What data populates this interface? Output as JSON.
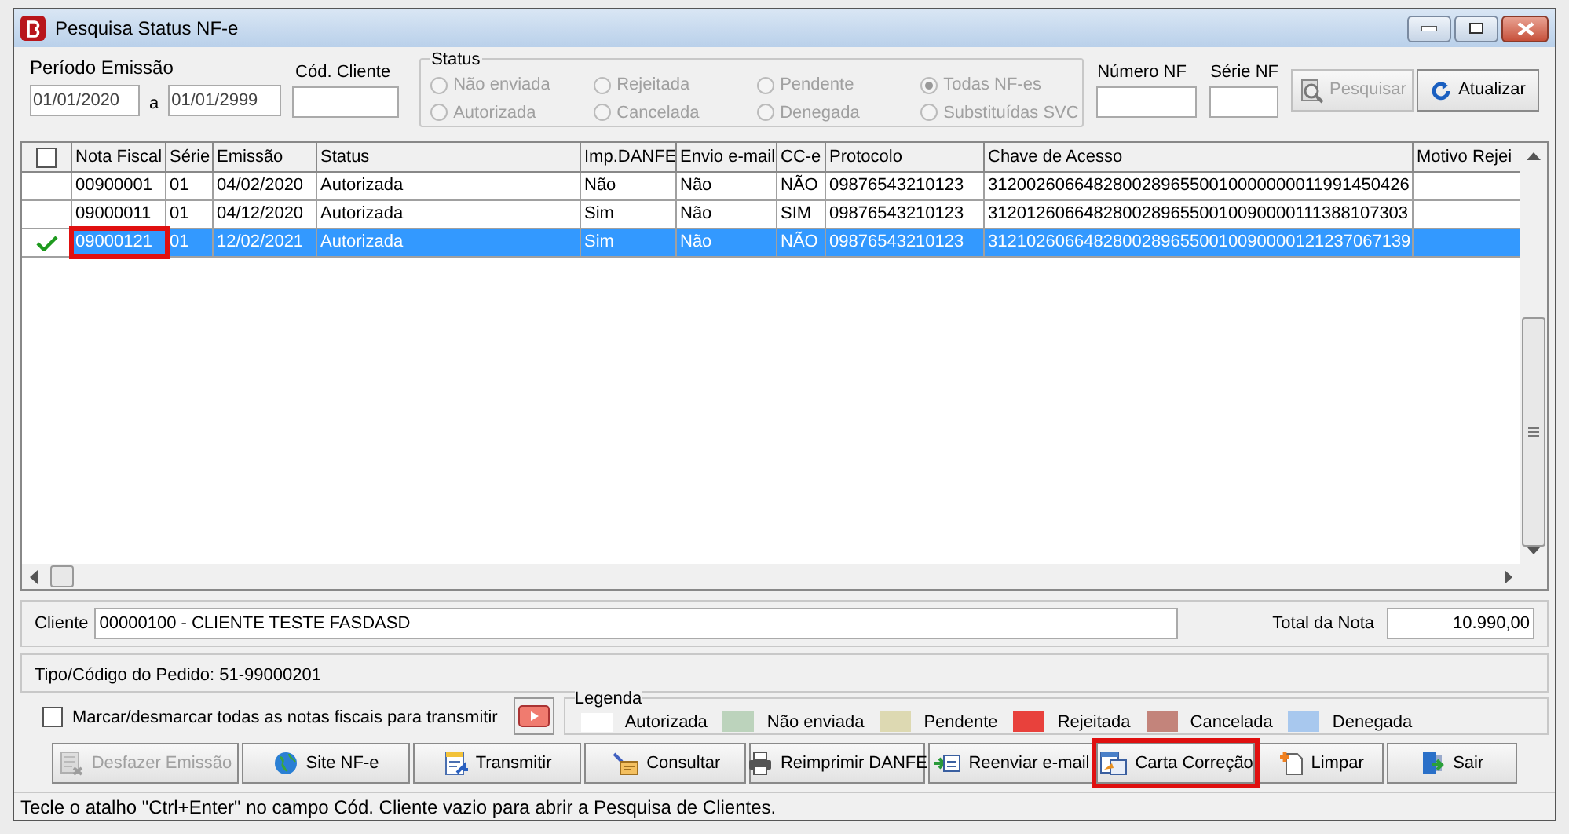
{
  "window": {
    "title": "Pesquisa Status NF-e"
  },
  "filters": {
    "periodo_label": "Período Emissão",
    "date_from": "01/01/2020",
    "date_sep": "a",
    "date_to": "01/01/2999",
    "cliente_label": "Cód. Cliente",
    "status_label": "Status",
    "status_disabled": true,
    "status_options": [
      {
        "label": "Não enviada",
        "selected": false
      },
      {
        "label": "Autorizada",
        "selected": false
      },
      {
        "label": "Rejeitada",
        "selected": false
      },
      {
        "label": "Cancelada",
        "selected": false
      },
      {
        "label": "Pendente",
        "selected": false
      },
      {
        "label": "Denegada",
        "selected": false
      },
      {
        "label": "Todas NF-es",
        "selected": true
      },
      {
        "label": "Substituídas SVC",
        "selected": false
      }
    ],
    "numero_label": "Número NF",
    "serie_label": "Série NF"
  },
  "top_buttons": [
    {
      "label": "Pesquisar",
      "disabled": true,
      "kind": "search"
    },
    {
      "label": "Atualizar",
      "disabled": false,
      "kind": "refresh"
    }
  ],
  "table": {
    "header_checked": false,
    "columns": [
      "Nota Fiscal",
      "Série",
      "Emissão",
      "Status",
      "Imp.DANFE",
      "Envio e-mail",
      "CC-e",
      "Protocolo",
      "Chave de Acesso",
      "Motivo Rejei"
    ],
    "rows": [
      {
        "checked": false,
        "selected": false,
        "red_frame": false,
        "cells": [
          "00900001",
          "01",
          "04/02/2020",
          "Autorizada",
          "Não",
          "Não",
          "NÃO",
          "09876543210123",
          "31200260664828002896550010000000011991450426",
          ""
        ]
      },
      {
        "checked": false,
        "selected": false,
        "red_frame": false,
        "cells": [
          "09000011",
          "01",
          "04/12/2020",
          "Autorizada",
          "Sim",
          "Não",
          "SIM",
          "09876543210123",
          "31201260664828002896550010090000111388107303",
          ""
        ]
      },
      {
        "checked": true,
        "selected": true,
        "red_frame": true,
        "cells": [
          "09000121",
          "01",
          "12/02/2021",
          "Autorizada",
          "Sim",
          "Não",
          "NÃO",
          "09876543210123",
          "31210260664828002896550010090000121237067139",
          ""
        ]
      }
    ]
  },
  "cliente": {
    "label": "Cliente",
    "value": "00000100 - CLIENTE TESTE FASDASD",
    "total_label": "Total da Nota",
    "total_value": "10.990,00"
  },
  "pedido": "Tipo/Código do Pedido: 51-99000201",
  "mark_all": {
    "label": "Marcar/desmarcar todas as notas fiscais para transmitir",
    "checked": false
  },
  "legend": {
    "title": "Legenda",
    "items": [
      {
        "label": "Autorizada",
        "color": "#ffffff"
      },
      {
        "label": "Não enviada",
        "color": "#bcd3bc"
      },
      {
        "label": "Pendente",
        "color": "#ddd9b2"
      },
      {
        "label": "Rejeitada",
        "color": "#e8413c"
      },
      {
        "label": "Cancelada",
        "color": "#c3847b"
      },
      {
        "label": "Denegada",
        "color": "#a8c8ee"
      }
    ]
  },
  "buttons": [
    {
      "label": "Desfazer Emissão",
      "kind": "undo",
      "disabled": true,
      "red_frame": false
    },
    {
      "label": "Site NF-e",
      "kind": "globe",
      "disabled": false,
      "red_frame": false
    },
    {
      "label": "Transmitir",
      "kind": "transmit",
      "disabled": false,
      "red_frame": false
    },
    {
      "label": "Consultar",
      "kind": "query",
      "disabled": false,
      "red_frame": false
    },
    {
      "label": "Reimprimir DANFE",
      "kind": "print",
      "disabled": false,
      "red_frame": false
    },
    {
      "label": "Reenviar e-mail",
      "kind": "mail",
      "disabled": false,
      "red_frame": false
    },
    {
      "label": "Carta Correção",
      "kind": "letter",
      "disabled": false,
      "red_frame": true
    },
    {
      "label": "Limpar",
      "kind": "clear",
      "disabled": false,
      "red_frame": false
    },
    {
      "label": "Sair",
      "kind": "exit",
      "disabled": false,
      "red_frame": false
    }
  ],
  "status_bar": "Tecle o atalho \"Ctrl+Enter\" no campo Cód. Cliente vazio para abrir a Pesquisa de Clientes."
}
